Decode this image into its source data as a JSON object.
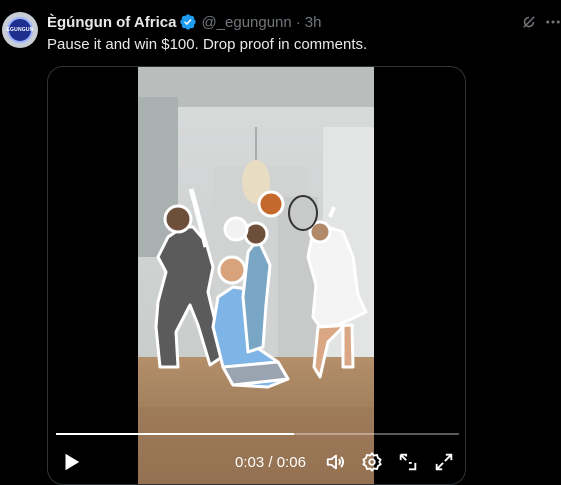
{
  "author": {
    "avatar_text": "EGUNGUN",
    "name": "Ègúngun of Africa",
    "handle": "@_egungunn",
    "separator": "·",
    "time": "3h"
  },
  "tweet": {
    "text": "Pause it and win $100. Drop proof in comments."
  },
  "video": {
    "current_time": "0:03",
    "duration": "0:06",
    "time_separator": " / ",
    "progress_fraction": 0.59
  },
  "icons": {
    "verified": "verified-badge-icon",
    "grok": "grok-icon",
    "more": "more-icon",
    "play": "play-icon",
    "volume": "volume-icon",
    "settings": "settings-icon",
    "pip": "picture-in-picture-icon",
    "fullscreen": "fullscreen-icon"
  },
  "colors": {
    "background": "#000000",
    "text_primary": "#e7e9ea",
    "text_secondary": "#71767b",
    "verified_blue": "#1d9bf0"
  }
}
